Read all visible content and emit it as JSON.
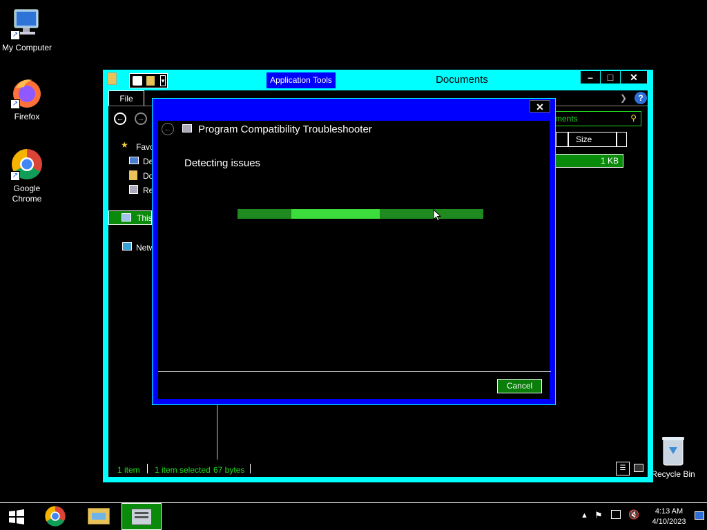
{
  "desktop": {
    "icons": [
      {
        "label": "My Computer"
      },
      {
        "label": "Firefox"
      },
      {
        "label": "Google Chrome"
      },
      {
        "label": "Recycle Bin"
      }
    ]
  },
  "explorer": {
    "title": "Documents",
    "app_tools": "Application Tools",
    "file_tab": "File",
    "search_placeholder": "ments",
    "column_size": "Size",
    "file_size": "1 KB",
    "nav": {
      "favorites": "Favo",
      "desktop": "De",
      "downloads": "Do",
      "recent": "Re",
      "this_pc": "This",
      "network": "Netw"
    },
    "status": {
      "items": "1 item",
      "selected": "1 item selected",
      "bytes": "67 bytes"
    },
    "controls": {
      "minimize": "–",
      "maximize": "□",
      "close": "✕"
    }
  },
  "dialog": {
    "title": "Program Compatibility Troubleshooter",
    "status_text": "Detecting issues",
    "progress_fraction": 0.58,
    "cancel_label": "Cancel",
    "close": "✕"
  },
  "taskbar": {
    "time": "4:13 AM",
    "date": "4/10/2023"
  },
  "colors": {
    "window_frame": "#00ffff",
    "dialog_frame": "#0000ff",
    "progress": "#2ecc2e",
    "selection": "#0a8a0a"
  }
}
